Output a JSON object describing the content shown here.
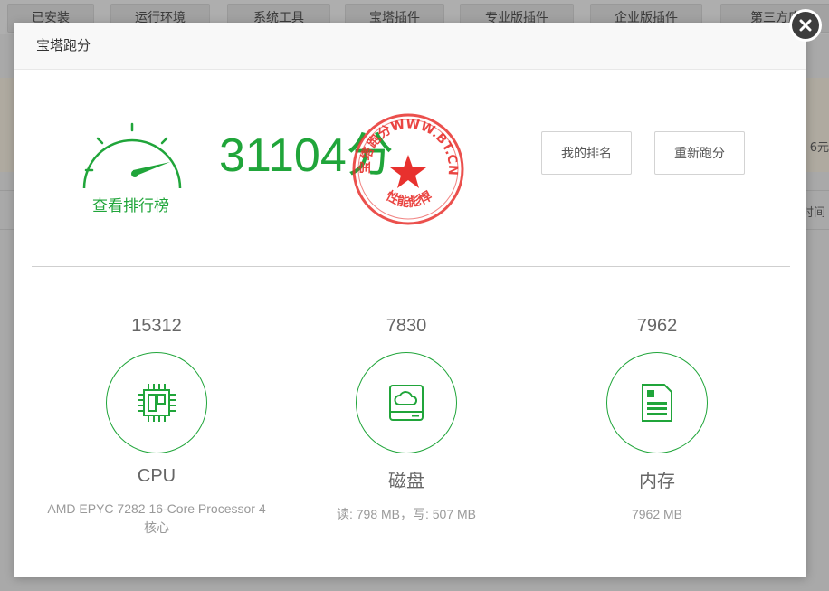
{
  "background": {
    "tabs": [
      "已安装",
      "运行环境",
      "系统工具",
      "宝塔插件",
      "专业版插件",
      "企业版插件",
      "第三方应"
    ],
    "right_text_1": "6元",
    "right_text_2": "时间"
  },
  "dialog": {
    "title": "宝塔跑分",
    "score": "31104",
    "score_unit": "分",
    "rank_link": "查看排行榜",
    "stamp_text": "宝塔跑分WWW.BT.CN",
    "stamp_motto": "性能彪悍",
    "buttons": {
      "my_rank": "我的排名",
      "rerun": "重新跑分"
    }
  },
  "metrics": {
    "cpu": {
      "value": "15312",
      "name": "CPU",
      "desc": "AMD EPYC 7282 16-Core Processor 4 核心",
      "icon": "cpu-chip-icon"
    },
    "disk": {
      "value": "7830",
      "name": "磁盘",
      "desc": "读: 798 MB，写: 507 MB",
      "icon": "disk-cloud-icon"
    },
    "memory": {
      "value": "7962",
      "name": "内存",
      "desc": "7962 MB",
      "icon": "memory-card-icon"
    }
  },
  "colors": {
    "accent": "#20a53a",
    "stamp": "#e8312e"
  }
}
